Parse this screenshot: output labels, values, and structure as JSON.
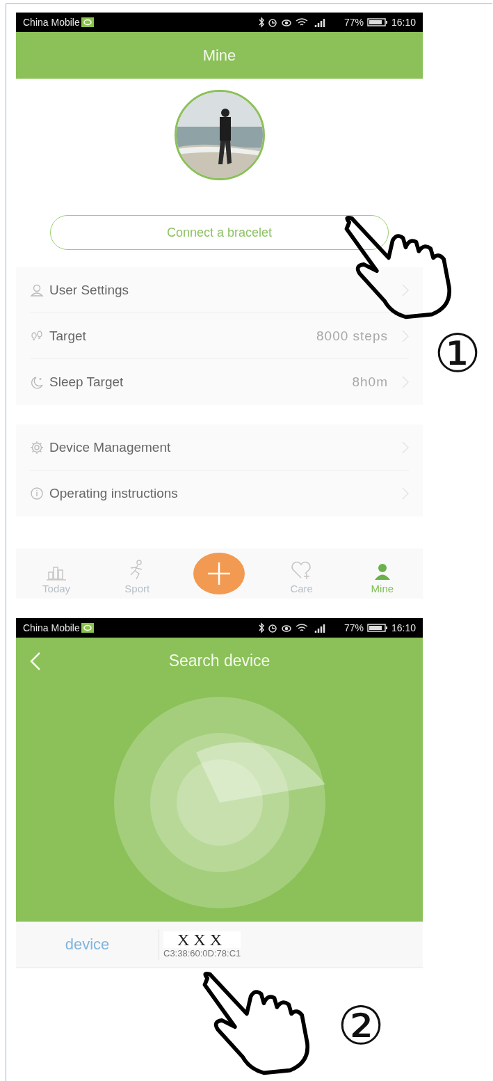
{
  "mine_screen": {
    "status_bar": {
      "carrier": "China Mobile",
      "battery": "77%",
      "time": "16:10"
    },
    "title": "Mine",
    "connect_button": "Connect a bracelet",
    "groups": [
      [
        {
          "label": "User Settings"
        },
        {
          "label": "Target",
          "value": "8000 steps"
        },
        {
          "label": "Sleep Target",
          "value": "8h0m"
        }
      ],
      [
        {
          "label": "Device Management"
        },
        {
          "label": "Operating instructions"
        }
      ]
    ],
    "tabs": [
      {
        "label": "Today",
        "selected": false
      },
      {
        "label": "Sport",
        "selected": false
      },
      {
        "label": "Care",
        "selected": false
      },
      {
        "label": "Mine",
        "selected": true
      }
    ]
  },
  "search_screen": {
    "status_bar": {
      "carrier": "China Mobile",
      "battery": "77%",
      "time": "16:10"
    },
    "title": "Search device",
    "device_row": {
      "label": "device",
      "name": "X X X",
      "address": "C3:38:60:0D:78:C1"
    }
  },
  "callouts": [
    {
      "number": "①"
    },
    {
      "number": "②"
    }
  ]
}
